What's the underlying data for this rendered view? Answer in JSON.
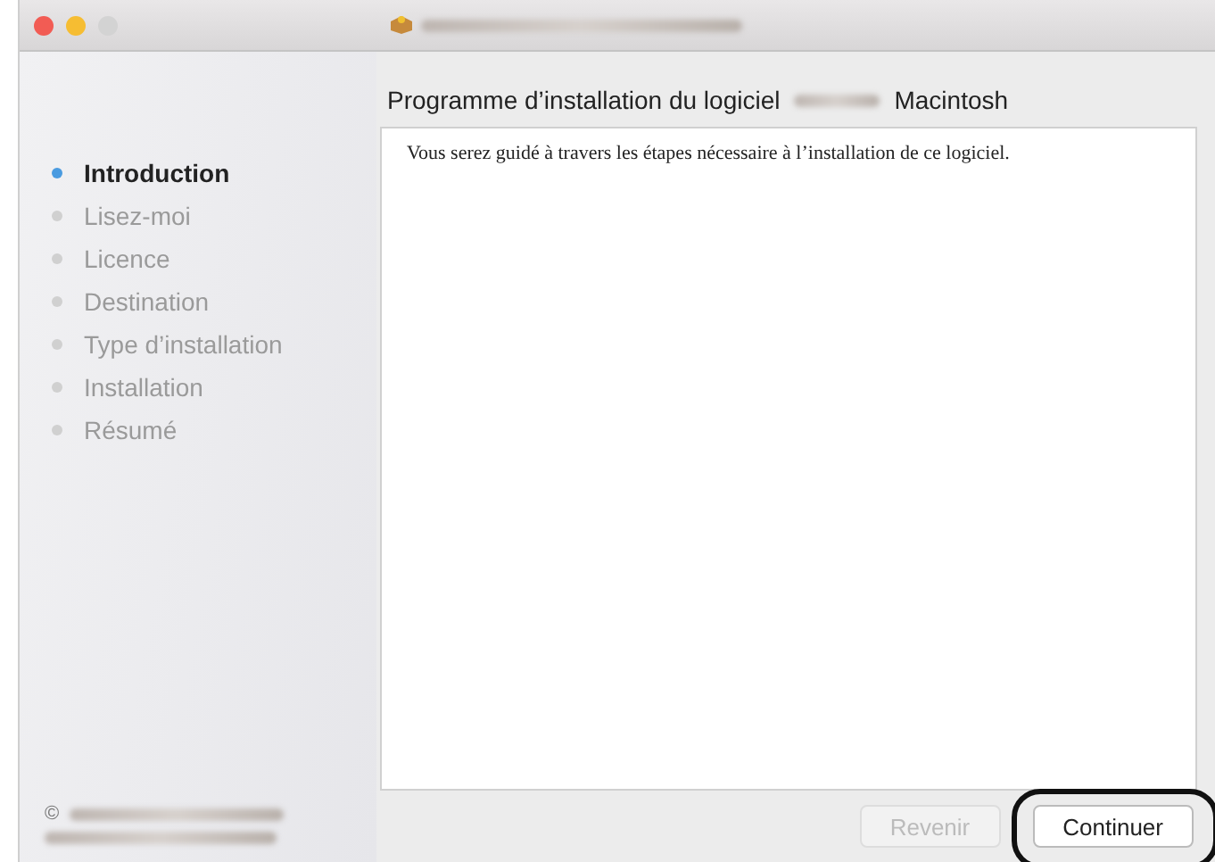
{
  "window": {
    "title_blurred": true
  },
  "heading": {
    "before": "Programme d’installation du logiciel",
    "after": "Macintosh"
  },
  "steps": [
    {
      "label": "Introduction",
      "selected": true
    },
    {
      "label": "Lisez-moi",
      "selected": false
    },
    {
      "label": "Licence",
      "selected": false
    },
    {
      "label": "Destination",
      "selected": false
    },
    {
      "label": "Type d’installation",
      "selected": false
    },
    {
      "label": "Installation",
      "selected": false
    },
    {
      "label": "Résumé",
      "selected": false
    }
  ],
  "body_text": "Vous serez guidé à travers les étapes nécessaire à l’installation de ce logiciel.",
  "copyright": {
    "symbol": "©"
  },
  "buttons": [
    {
      "label": "Revenir",
      "disabled": true,
      "highlighted": false
    },
    {
      "label": "Continuer",
      "disabled": false,
      "highlighted": true
    }
  ]
}
